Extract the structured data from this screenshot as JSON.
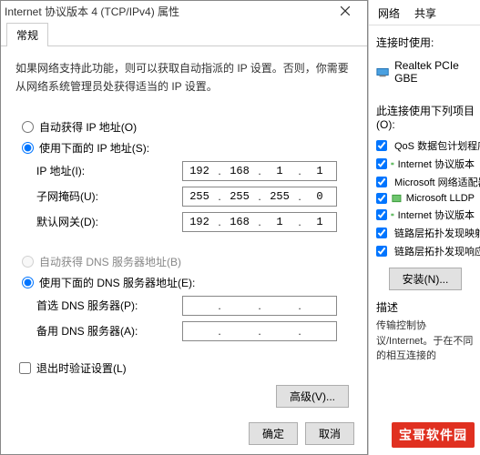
{
  "dialog": {
    "title": "Internet 协议版本 4 (TCP/IPv4) 属性",
    "tab": "常规",
    "intro": "如果网络支持此功能，则可以获取自动指派的 IP 设置。否则，你需要从网络系统管理员处获得适当的 IP 设置。",
    "radio_auto_ip": "自动获得 IP 地址(O)",
    "radio_manual_ip": "使用下面的 IP 地址(S):",
    "ip_label": "IP 地址(I):",
    "mask_label": "子网掩码(U):",
    "gateway_label": "默认网关(D):",
    "radio_auto_dns": "自动获得 DNS 服务器地址(B)",
    "radio_manual_dns": "使用下面的 DNS 服务器地址(E):",
    "dns1_label": "首选 DNS 服务器(P):",
    "dns2_label": "备用 DNS 服务器(A):",
    "ip": [
      "192",
      "168",
      "1",
      "1"
    ],
    "mask": [
      "255",
      "255",
      "255",
      "0"
    ],
    "gateway": [
      "192",
      "168",
      "1",
      "1"
    ],
    "dns1": [
      "",
      "",
      "",
      ""
    ],
    "dns2": [
      "",
      "",
      "",
      ""
    ],
    "validate_checkbox": "退出时验证设置(L)",
    "advanced_btn": "高级(V)...",
    "ok_btn": "确定",
    "cancel_btn": "取消"
  },
  "bgwin": {
    "tab_net": "网络",
    "tab_share": "共享",
    "connect_using": "连接时使用:",
    "adapter": "Realtek PCIe GBE",
    "items_label": "此连接使用下列项目(O):",
    "items": [
      "QoS 数据包计划程序",
      "Internet 协议版本",
      "Microsoft 网络适配器",
      "Microsoft LLDP",
      "Internet 协议版本",
      "链路层拓扑发现映射",
      "链路层拓扑发现响应"
    ],
    "install_btn": "安装(N)...",
    "desc_label": "描述",
    "desc_text": "传输控制协议/Internet。于在不同的相互连接的"
  },
  "watermark": "宝哥软件园"
}
